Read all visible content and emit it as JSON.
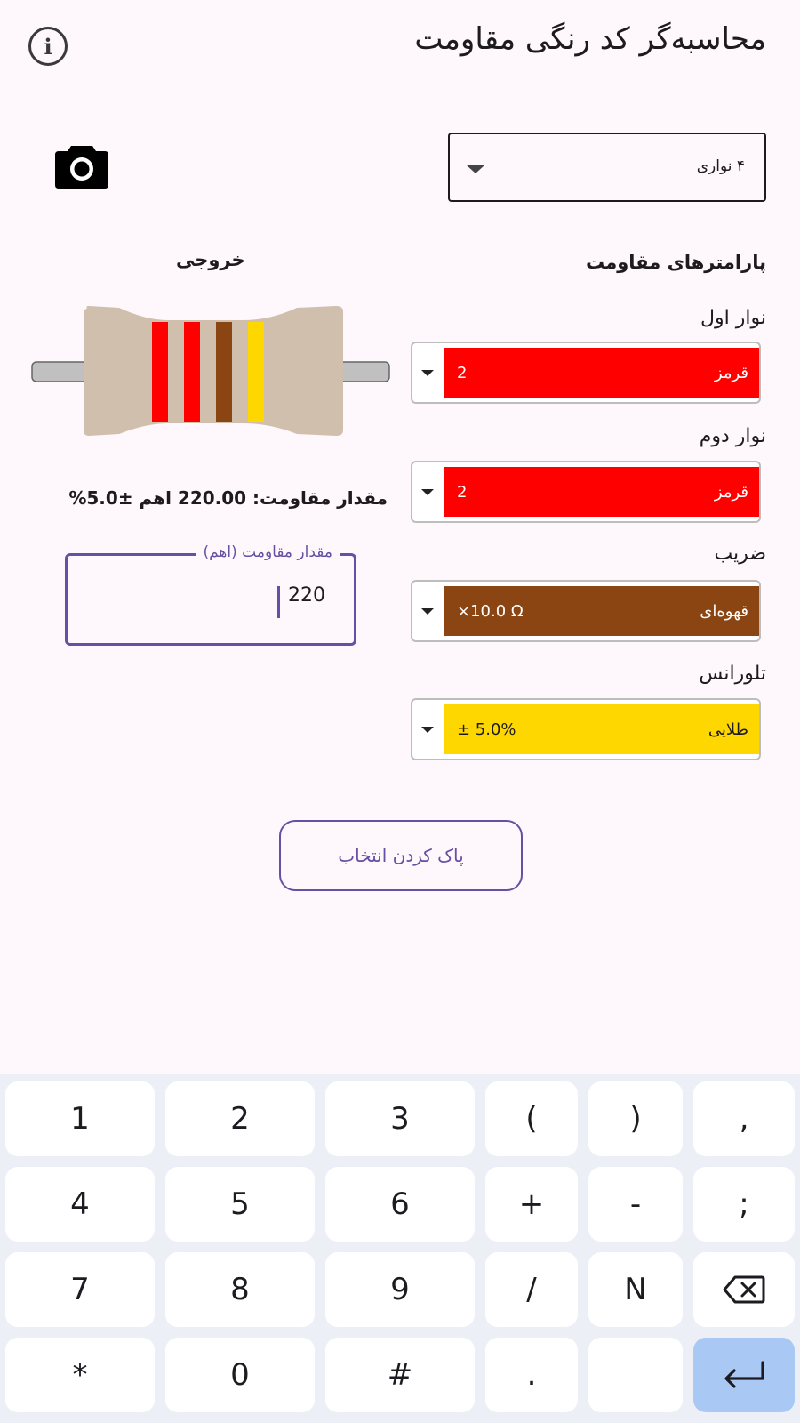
{
  "app": {
    "title": "محاسبه‌گر کد رنگی مقاومت"
  },
  "band_count": {
    "selected": "۴ نواری"
  },
  "sections": {
    "params_title": "پارامترهای مقاومت",
    "output_title": "خروجی"
  },
  "bands": [
    {
      "label": "نوار اول",
      "color_name": "قرمز",
      "value": "2",
      "color": "#ff0000"
    },
    {
      "label": "نوار دوم",
      "color_name": "قرمز",
      "value": "2",
      "color": "#ff0000"
    },
    {
      "label": "ضریب",
      "color_name": "قهوه‌ای",
      "value": "×10.0 Ω",
      "color": "#8b4513"
    },
    {
      "label": "تلورانس",
      "color_name": "طلایی",
      "value": "± 5.0%",
      "color": "#ffd700"
    }
  ],
  "resistor": {
    "body_color": "#d0bfad",
    "band_colors": [
      "#ff0000",
      "#ff0000",
      "#8b4513",
      "#ffd700"
    ]
  },
  "result": {
    "text": "مقدار مقاومت: 220.00 اهم ±5.0%"
  },
  "resistance_input": {
    "label": "مقدار مقاومت (اهم)",
    "value": "220"
  },
  "actions": {
    "clear_label": "پاک کردن انتخاب"
  },
  "keyboard": {
    "rows": [
      [
        "1",
        "2",
        "3",
        "(",
        ")",
        ","
      ],
      [
        "4",
        "5",
        "6",
        "+",
        "-",
        ";"
      ],
      [
        "7",
        "8",
        "9",
        "/",
        "N",
        "backspace-icon"
      ],
      [
        "*",
        "0",
        "#",
        ".",
        "",
        "enter-icon"
      ]
    ]
  },
  "colors": {
    "accent": "#6750a4",
    "background": "#fef7fc",
    "enter_key": "#a9c9f4"
  }
}
